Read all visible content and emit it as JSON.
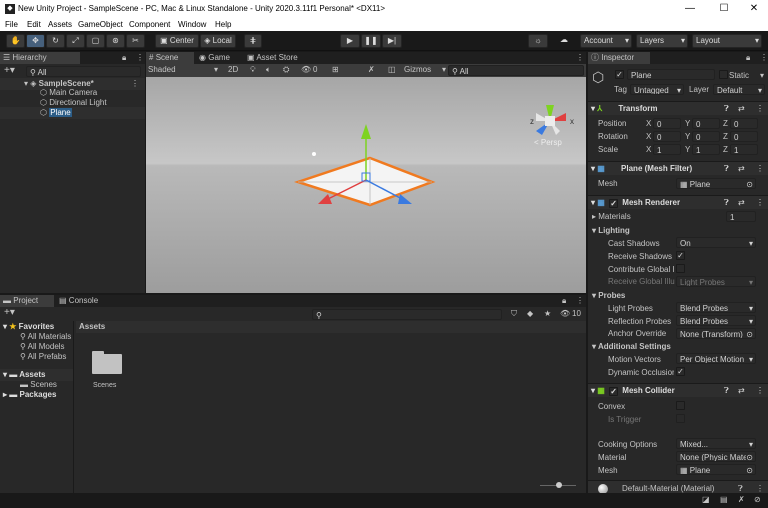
{
  "window": {
    "title": "New Unity Project - SampleScene - PC, Mac & Linux Standalone - Unity 2020.3.11f1 Personal* <DX11>",
    "minimize": "—",
    "maximize": "☐",
    "close": "✕"
  },
  "menu": [
    "File",
    "Edit",
    "Assets",
    "GameObject",
    "Component",
    "Window",
    "Help"
  ],
  "toolbar": {
    "center": "Center",
    "local": "Local",
    "account": "Account",
    "layers": "Layers",
    "layout": "Layout"
  },
  "hierarchy": {
    "tab": "Hierarchy",
    "search": "All",
    "scene": "SampleScene*",
    "items": [
      "Main Camera",
      "Directional Light",
      "Plane"
    ]
  },
  "scene": {
    "tabs": [
      "Scene",
      "Game",
      "Asset Store"
    ],
    "shading": "Shaded",
    "mode2d": "2D",
    "hidden_count": "0",
    "gizmos": "Gizmos",
    "search": "All",
    "persp": "< Persp",
    "axis_x": "x",
    "axis_z": "z"
  },
  "project": {
    "tabs": [
      "Project",
      "Console"
    ],
    "favorites": "Favorites",
    "fav_items": [
      "All Materials",
      "All Models",
      "All Prefabs"
    ],
    "assets_root": "Assets",
    "assets_children": [
      "Scenes"
    ],
    "packages": "Packages",
    "breadcrumb": "Assets",
    "folders": [
      "Scenes"
    ],
    "count": "10"
  },
  "inspector": {
    "tab": "Inspector",
    "name": "Plane",
    "static": "Static",
    "tag_label": "Tag",
    "tag": "Untagged",
    "layer_label": "Layer",
    "layer": "Default",
    "transform": {
      "title": "Transform",
      "rows": [
        {
          "label": "Position",
          "x": "0",
          "y": "0",
          "z": "0"
        },
        {
          "label": "Rotation",
          "x": "0",
          "y": "0",
          "z": "0"
        },
        {
          "label": "Scale",
          "x": "1",
          "y": "1",
          "z": "1"
        }
      ]
    },
    "mesh_filter": {
      "title": "Plane (Mesh Filter)",
      "mesh_label": "Mesh",
      "mesh": "Plane"
    },
    "mesh_renderer": {
      "title": "Mesh Renderer",
      "materials_label": "Materials",
      "materials_count": "1",
      "lighting": "Lighting",
      "cast_shadows_label": "Cast Shadows",
      "cast_shadows": "On",
      "receive_shadows_label": "Receive Shadows",
      "contribute_gi_label": "Contribute Global I",
      "receive_gi_label": "Receive Global Illu",
      "receive_gi": "Light Probes",
      "probes": "Probes",
      "light_probes_label": "Light Probes",
      "light_probes": "Blend Probes",
      "reflection_probes_label": "Reflection Probes",
      "reflection_probes": "Blend Probes",
      "anchor_override_label": "Anchor Override",
      "anchor_override": "None (Transform)",
      "additional": "Additional Settings",
      "motion_vectors_label": "Motion Vectors",
      "motion_vectors": "Per Object Motion",
      "dynamic_occlusion_label": "Dynamic Occlusion"
    },
    "mesh_collider": {
      "title": "Mesh Collider",
      "convex_label": "Convex",
      "is_trigger_label": "Is Trigger",
      "cooking_label": "Cooking Options",
      "cooking": "Mixed...",
      "material_label": "Material",
      "material": "None (Physic Mate",
      "mesh_label": "Mesh",
      "mesh": "Plane"
    },
    "default_material": "Default-Material (Material)"
  },
  "colors": {
    "accent": "#2c5d87",
    "orange": "#f07a20",
    "bg": "#282828"
  }
}
